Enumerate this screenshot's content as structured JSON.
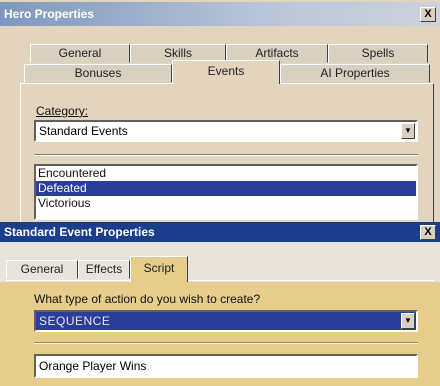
{
  "hero_window": {
    "title": "Hero Properties",
    "close": "X",
    "tabs_back": [
      "General",
      "Skills",
      "Artifacts",
      "Spells"
    ],
    "tabs_front": [
      "Bonuses",
      "Events",
      "AI Properties"
    ],
    "category_label": "Category:",
    "category_value": "Standard Events",
    "events": [
      {
        "label": "Encountered",
        "selected": false
      },
      {
        "label": "Defeated",
        "selected": true
      },
      {
        "label": "Victorious",
        "selected": false
      }
    ]
  },
  "event_window": {
    "title": "Standard Event Properties",
    "close": "X",
    "tabs": [
      "General",
      "Effects",
      "Script"
    ],
    "active_tab": "Script",
    "question": "What type of action do you wish to create?",
    "action_value": "SEQUENCE",
    "name_value": "Orange Player Wins"
  },
  "colors": {
    "title_bar": "#1a3e8c",
    "selection": "#2a3e98",
    "dialog_face": "#d8d0c0",
    "background": "#e8d6b9"
  }
}
